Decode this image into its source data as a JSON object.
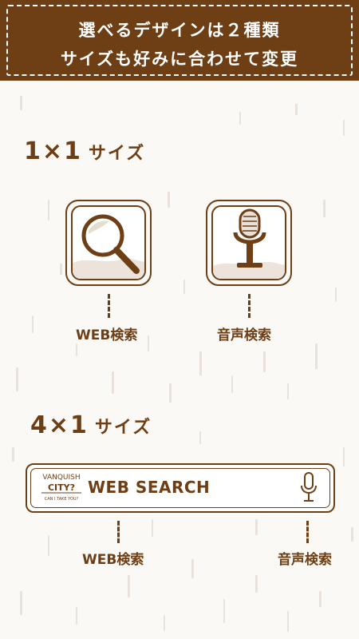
{
  "header": {
    "line1": "選べるデザインは２種類",
    "line2": "サイズも好みに合わせて変更"
  },
  "section_1x1": {
    "size": "1×1",
    "label": "サイズ",
    "web_caption": "WEB検索",
    "voice_caption": "音声検索",
    "icons": [
      "magnifier-icon",
      "microphone-icon"
    ]
  },
  "section_4x1": {
    "size": "4×1",
    "label": "サイズ",
    "search_text": "WEB SEARCH",
    "logo_top": "VANQUISH",
    "logo_mid": "CITY?",
    "logo_bottom": "CAN I TAKE YOU?",
    "web_caption": "WEB検索",
    "voice_caption": "音声検索",
    "icons": [
      "vanquish-logo",
      "microphone-icon"
    ]
  },
  "colors": {
    "brand_brown": "#6e3e14",
    "background": "#fbf9f6",
    "header_text": "#ffffff"
  }
}
